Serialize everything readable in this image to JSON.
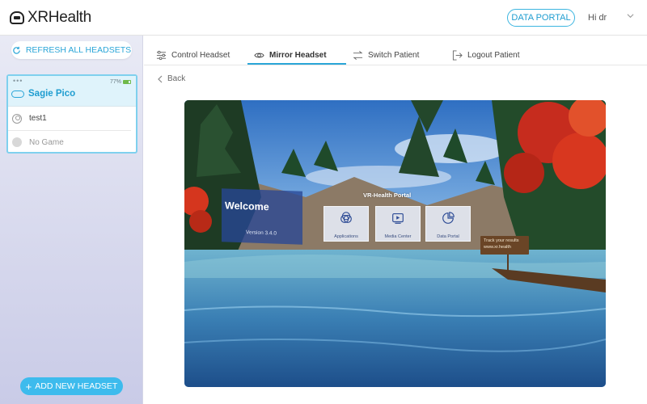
{
  "header": {
    "logo_text": "XRHealth",
    "data_portal_label": "DATA PORTAL",
    "greeting": "Hi dr",
    "logo_icon": "headset-logo-icon",
    "menu_icon": "chevron-down-icon"
  },
  "sidebar": {
    "refresh_label": "REFRESH ALL HEADSETS",
    "add_label": "ADD NEW HEADSET",
    "headset": {
      "battery": "77%",
      "battery_fraction": 0.77,
      "name": "Sagie Pico",
      "user": "test1",
      "game": "No Game"
    }
  },
  "tabs": [
    {
      "label": "Control Headset",
      "icon": "sliders-icon"
    },
    {
      "label": "Mirror Headset",
      "icon": "eye-icon",
      "active": true
    },
    {
      "label": "Switch Patient",
      "icon": "swap-arrows-icon"
    },
    {
      "label": "Logout Patient",
      "icon": "logout-icon"
    }
  ],
  "back_label": "Back",
  "mirror": {
    "welcome_title": "Welcome",
    "version": "Version 3.4.0",
    "portal_title": "VR-Health Portal",
    "tiles": [
      {
        "label": "Applications",
        "icon": "venn-icon"
      },
      {
        "label": "Media Center",
        "icon": "play-icon"
      },
      {
        "label": "Data Portal",
        "icon": "pie-chart-icon"
      }
    ],
    "sign_line1": "Track your results",
    "sign_line2": "www.xr.health"
  },
  "colors": {
    "accent": "#2ba6d8",
    "add_button": "#3dbbed",
    "sidebar_top": "#e9eaf5",
    "sidebar_bottom": "#c9cbe7"
  }
}
